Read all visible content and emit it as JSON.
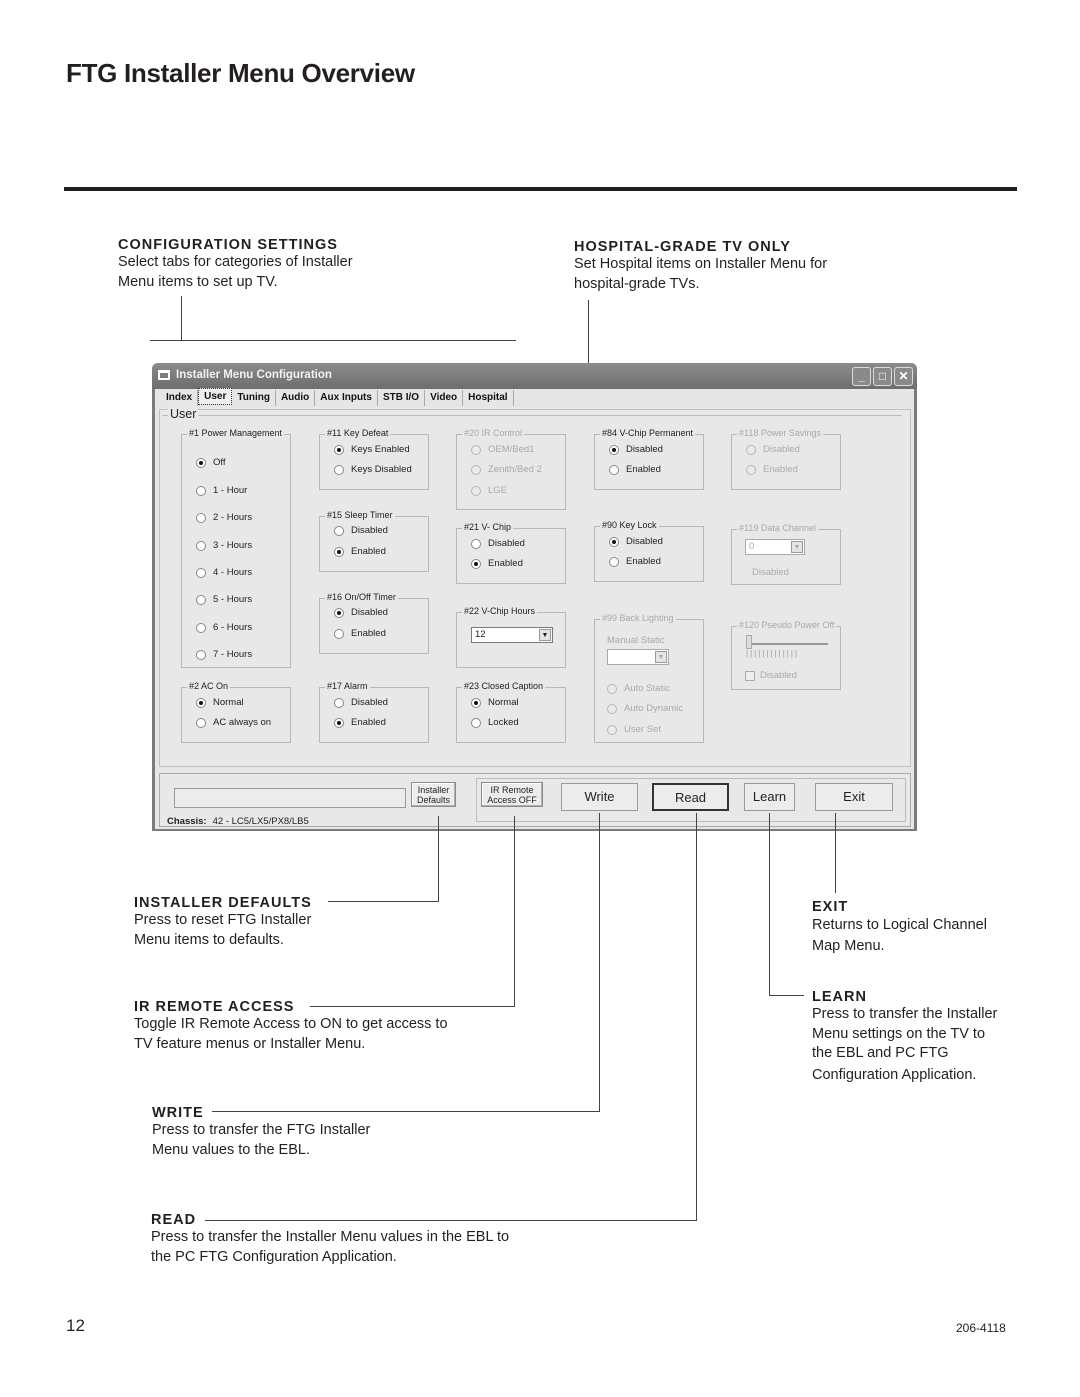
{
  "page": {
    "title": "FTG Installer Menu Overview",
    "page_number": "12",
    "doc_number": "206-4118"
  },
  "callouts": {
    "configuration_settings": {
      "heading": "CONFIGURATION SETTINGS",
      "lines": [
        "Select tabs for categories of Installer",
        "Menu items to set up TV."
      ]
    },
    "hospital_grade": {
      "heading": "HOSPITAL-GRADE TV ONLY",
      "lines": [
        "Set Hospital items on Installer Menu for",
        "hospital-grade TVs."
      ]
    },
    "installer_defaults": {
      "heading": "INSTALLER DEFAULTS",
      "lines": [
        "Press to reset FTG Installer",
        "Menu items to defaults."
      ]
    },
    "ir_remote_access": {
      "heading": "IR REMOTE ACCESS",
      "lines": [
        "Toggle IR Remote Access to ON to get access to",
        "TV feature menus or Installer Menu."
      ]
    },
    "write": {
      "heading": "WRITE",
      "lines": [
        "Press to transfer the FTG Installer",
        "Menu values to the EBL."
      ]
    },
    "read": {
      "heading": "READ",
      "lines": [
        "Press to transfer the Installer Menu values in the EBL to",
        "the PC FTG Configuration Application."
      ]
    },
    "exit": {
      "heading": "EXIT",
      "lines": [
        "Returns to Logical Channel",
        "Map Menu."
      ]
    },
    "learn": {
      "heading": "LEARN",
      "lines": [
        "Press to transfer the Installer",
        "Menu settings on the TV to",
        "the EBL and PC FTG",
        "Configuration Application."
      ]
    }
  },
  "window": {
    "title": "Installer Menu Configuration",
    "controls": {
      "minimize": "_",
      "maximize": "□",
      "close": "✕"
    },
    "tabs": [
      "Index",
      "User",
      "Tuning",
      "Audio",
      "Aux Inputs",
      "STB I/O",
      "Video",
      "Hospital"
    ],
    "active_tab": "User",
    "pane_title": "User",
    "groups": {
      "power_mgmt": {
        "label": "#1 Power Management",
        "options": [
          "Off",
          "1 - Hour",
          "2 - Hours",
          "3 - Hours",
          "4 - Hours",
          "5 - Hours",
          "6 - Hours",
          "7 - Hours"
        ],
        "selected": "Off"
      },
      "key_defeat": {
        "label": "#11 Key Defeat",
        "options": [
          "Keys Enabled",
          "Keys Disabled"
        ],
        "selected": "Keys Enabled"
      },
      "sleep_timer": {
        "label": "#15 Sleep Timer",
        "options": [
          "Disabled",
          "Enabled"
        ],
        "selected": "Enabled"
      },
      "onoff_timer": {
        "label": "#16 On/Off Timer",
        "options": [
          "Disabled",
          "Enabled"
        ],
        "selected": "Disabled"
      },
      "ir_control": {
        "label": "#20 IR Control",
        "options": [
          "OEM/Bed1",
          "Zenith/Bed 2",
          "LGE"
        ],
        "selected": null,
        "disabled": true
      },
      "vchip": {
        "label": "#21 V- Chip",
        "options": [
          "Disabled",
          "Enabled"
        ],
        "selected": "Enabled"
      },
      "vchip_hours": {
        "label": "#22 V-Chip Hours",
        "value": "12"
      },
      "vchip_perm": {
        "label": "#84 V-Chip Permanent",
        "options": [
          "Disabled",
          "Enabled"
        ],
        "selected": "Disabled"
      },
      "key_lock": {
        "label": "#90 Key Lock",
        "options": [
          "Disabled",
          "Enabled"
        ],
        "selected": "Disabled"
      },
      "back_lighting": {
        "label": "#99 Back Lighting",
        "sublabel": "Manual Static",
        "value": "",
        "options": [
          "Auto Static",
          "Auto Dynamic",
          "User Set"
        ],
        "disabled": true
      },
      "power_savings": {
        "label": "#118 Power Savings",
        "options": [
          "Disabled",
          "Enabled"
        ],
        "disabled": true
      },
      "data_channel": {
        "label": "#119 Data Channel",
        "value": "0",
        "status": "Disabled",
        "disabled": true
      },
      "pseudo_power": {
        "label": "#120 Pseudo Power Off",
        "checkbox": "Disabled",
        "slider_value": 0,
        "disabled": true
      },
      "ac_on": {
        "label": "#2 AC On",
        "options": [
          "Normal",
          "AC always on"
        ],
        "selected": "Normal"
      },
      "alarm": {
        "label": "#17 Alarm",
        "options": [
          "Disabled",
          "Enabled"
        ],
        "selected": "Enabled"
      },
      "closed_caption": {
        "label": "#23 Closed Caption",
        "options": [
          "Normal",
          "Locked"
        ],
        "selected": "Normal"
      }
    },
    "bottom": {
      "status_text": "",
      "chassis_label": "Chassis:",
      "chassis_value": "42 - LC5/LX5/PX8/LB5",
      "installer_defaults": [
        "Installer",
        "Defaults"
      ],
      "ir_remote": [
        "IR Remote",
        "Access OFF"
      ],
      "write": "Write",
      "read": "Read",
      "learn": "Learn",
      "exit": "Exit"
    }
  }
}
